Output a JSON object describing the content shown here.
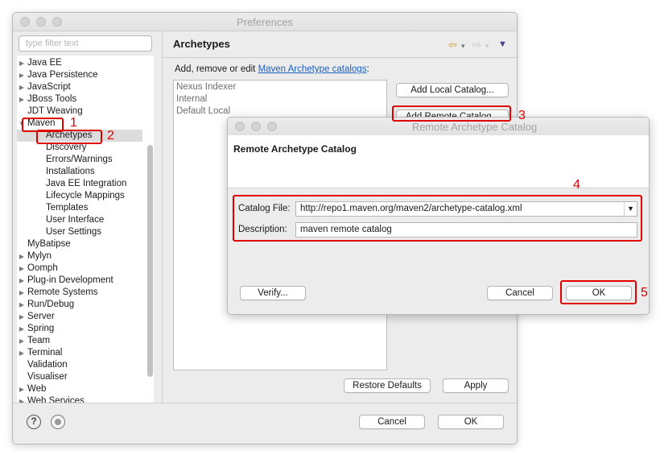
{
  "main_window": {
    "title": "Preferences",
    "filter_placeholder": "type filter text",
    "tree": [
      {
        "label": "Java EE",
        "arrow": "▶"
      },
      {
        "label": "Java Persistence",
        "arrow": "▶"
      },
      {
        "label": "JavaScript",
        "arrow": "▶"
      },
      {
        "label": "JBoss Tools",
        "arrow": "▶"
      },
      {
        "label": "JDT Weaving",
        "arrow": ""
      },
      {
        "label": "Maven",
        "arrow": "▼"
      },
      {
        "label": "Archetypes",
        "arrow": ""
      },
      {
        "label": "Discovery",
        "arrow": ""
      },
      {
        "label": "Errors/Warnings",
        "arrow": ""
      },
      {
        "label": "Installations",
        "arrow": ""
      },
      {
        "label": "Java EE Integration",
        "arrow": ""
      },
      {
        "label": "Lifecycle Mappings",
        "arrow": ""
      },
      {
        "label": "Templates",
        "arrow": ""
      },
      {
        "label": "User Interface",
        "arrow": ""
      },
      {
        "label": "User Settings",
        "arrow": ""
      },
      {
        "label": "MyBatipse",
        "arrow": ""
      },
      {
        "label": "Mylyn",
        "arrow": "▶"
      },
      {
        "label": "Oomph",
        "arrow": "▶"
      },
      {
        "label": "Plug-in Development",
        "arrow": "▶"
      },
      {
        "label": "Remote Systems",
        "arrow": "▶"
      },
      {
        "label": "Run/Debug",
        "arrow": "▶"
      },
      {
        "label": "Server",
        "arrow": "▶"
      },
      {
        "label": "Spring",
        "arrow": "▶"
      },
      {
        "label": "Team",
        "arrow": "▶"
      },
      {
        "label": "Terminal",
        "arrow": "▶"
      },
      {
        "label": "Validation",
        "arrow": ""
      },
      {
        "label": "Visualiser",
        "arrow": ""
      },
      {
        "label": "Web",
        "arrow": "▶"
      },
      {
        "label": "Web Services",
        "arrow": "▶"
      }
    ],
    "page_title": "Archetypes",
    "description_prefix": "Add, remove or edit ",
    "description_link": "Maven Archetype catalogs",
    "description_suffix": ":",
    "catalogs": [
      "Nexus Indexer",
      "Internal",
      "Default Local"
    ],
    "add_local_label": "Add Local Catalog...",
    "add_remote_label": "Add Remote Catalog...",
    "restore_defaults_label": "Restore Defaults",
    "apply_label": "Apply",
    "cancel_label": "Cancel",
    "ok_label": "OK",
    "help_glyph": "?"
  },
  "dialog": {
    "title": "Remote Archetype Catalog",
    "heading": "Remote Archetype Catalog",
    "catalog_file_label": "Catalog File:",
    "catalog_file_value": "http://repo1.maven.org/maven2/archetype-catalog.xml",
    "description_label": "Description:",
    "description_value": "maven remote catalog",
    "verify_label": "Verify...",
    "cancel_label": "Cancel",
    "ok_label": "OK"
  },
  "annotations": [
    "1",
    "2",
    "3",
    "4",
    "5"
  ],
  "colors": {
    "highlight": "#e00000",
    "link": "#1c5fc4",
    "accent": "#4b3a8b"
  },
  "icons": {
    "back": "⇦",
    "forward": "⇨",
    "dropdown": "▾",
    "menu": "▼"
  }
}
